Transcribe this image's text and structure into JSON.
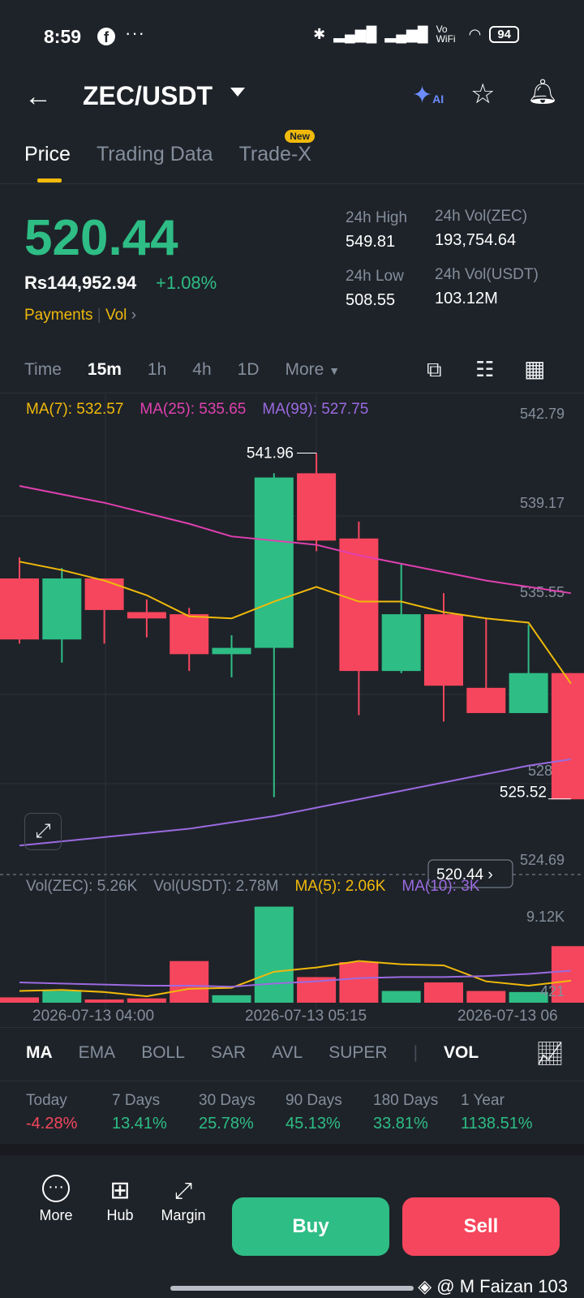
{
  "status": {
    "time": "8:59",
    "fb": "f",
    "dots": "···",
    "network": "Vo WiFi",
    "battery": "94"
  },
  "header": {
    "pair": "ZEC/USDT",
    "ai_label": "AI"
  },
  "tabs": [
    {
      "label": "Price"
    },
    {
      "label": "Trading Data"
    },
    {
      "label": "Trade-X",
      "badge": "New"
    }
  ],
  "price": {
    "last": "520.44",
    "fiat": "Rs144,952.94",
    "change": "+1.08%",
    "payments": "Payments",
    "vol": "Vol"
  },
  "stats": {
    "high_label": "24h High",
    "high": "549.81",
    "low_label": "24h Low",
    "low": "508.55",
    "vol_zec_label": "24h Vol(ZEC)",
    "vol_zec": "193,754.64",
    "vol_usdt_label": "24h Vol(USDT)",
    "vol_usdt": "103.12M"
  },
  "timeframes": [
    "Time",
    "15m",
    "1h",
    "4h",
    "1D",
    "More"
  ],
  "ma_legend": {
    "ma7": "MA(7): 532.57",
    "ma25": "MA(25): 535.65",
    "ma99": "MA(99): 527.75"
  },
  "vol_legend": {
    "zec": "Vol(ZEC): 5.26K",
    "usdt": "Vol(USDT): 2.78M",
    "ma5": "MA(5): 2.06K",
    "ma10": "MA(10): 3K"
  },
  "chart_data": {
    "type": "candlestick",
    "y_ticks": [
      "542.79",
      "539.17",
      "535.55",
      "528.3",
      "524.69"
    ],
    "ylim": [
      522.0,
      543.6
    ],
    "high_marker": "541.96",
    "low_marker": "525.52",
    "last_price_tag": "520.44",
    "x_ticks": [
      "2026-07-13 04:00",
      "2026-07-13 05:15",
      "2026-07-13 06"
    ],
    "candles": [
      {
        "o": 536.0,
        "h": 537.0,
        "l": 532.9,
        "c": 533.1
      },
      {
        "o": 533.1,
        "h": 536.5,
        "l": 532.0,
        "c": 536.0
      },
      {
        "o": 536.0,
        "h": 536.0,
        "l": 532.9,
        "c": 534.5
      },
      {
        "o": 534.4,
        "h": 535.0,
        "l": 533.2,
        "c": 534.1
      },
      {
        "o": 534.3,
        "h": 534.6,
        "l": 531.6,
        "c": 532.4
      },
      {
        "o": 532.4,
        "h": 533.3,
        "l": 531.3,
        "c": 532.7
      },
      {
        "o": 532.7,
        "h": 541.0,
        "l": 525.6,
        "c": 540.8
      },
      {
        "o": 541.0,
        "h": 541.96,
        "l": 537.3,
        "c": 537.8
      },
      {
        "o": 537.9,
        "h": 538.7,
        "l": 529.5,
        "c": 531.6
      },
      {
        "o": 531.6,
        "h": 536.7,
        "l": 531.5,
        "c": 534.3
      },
      {
        "o": 534.3,
        "h": 535.3,
        "l": 529.2,
        "c": 530.9
      },
      {
        "o": 530.8,
        "h": 534.1,
        "l": 529.9,
        "c": 529.6
      },
      {
        "o": 529.6,
        "h": 533.8,
        "l": 530.3,
        "c": 531.5
      },
      {
        "o": 531.5,
        "h": 531.5,
        "l": 525.52,
        "c": 525.5
      }
    ],
    "ma7": [
      536.8,
      536.4,
      535.9,
      535.2,
      534.2,
      534.1,
      534.9,
      535.6,
      534.9,
      534.9,
      534.4,
      534.1,
      533.9,
      531.0
    ],
    "ma25": [
      540.4,
      540.0,
      539.6,
      539.1,
      538.6,
      538.0,
      537.8,
      537.6,
      537.1,
      536.7,
      536.3,
      535.9,
      535.6,
      535.3
    ],
    "ma99": [
      523.3,
      523.5,
      523.7,
      523.9,
      524.1,
      524.4,
      524.7,
      525.1,
      525.5,
      525.9,
      526.3,
      526.7,
      527.1,
      527.4
    ],
    "vol_ticks": [
      "9.12K",
      "421"
    ],
    "volume": [
      0.5,
      1.1,
      0.3,
      0.4,
      3.9,
      0.7,
      9.0,
      2.4,
      3.8,
      1.1,
      1.9,
      1.1,
      1.0,
      5.3
    ],
    "vol_ma5": [
      1.1,
      1.2,
      1.0,
      0.6,
      1.3,
      1.4,
      2.9,
      3.3,
      3.9,
      3.6,
      3.5,
      2.0,
      1.6,
      2.06
    ],
    "vol_ma10": [
      1.9,
      1.8,
      1.7,
      1.6,
      1.6,
      1.5,
      1.8,
      2.0,
      2.3,
      2.4,
      2.4,
      2.5,
      2.7,
      3.0
    ]
  },
  "indicator_tabs": [
    "MA",
    "EMA",
    "BOLL",
    "SAR",
    "AVL",
    "SUPER",
    "VOL"
  ],
  "performance": [
    {
      "label": "Today",
      "value": "-4.28%",
      "color": "#f6465d"
    },
    {
      "label": "7 Days",
      "value": "13.41%",
      "color": "#2ebd85"
    },
    {
      "label": "30 Days",
      "value": "25.78%",
      "color": "#2ebd85"
    },
    {
      "label": "90 Days",
      "value": "45.13%",
      "color": "#2ebd85"
    },
    {
      "label": "180 Days",
      "value": "33.81%",
      "color": "#2ebd85"
    },
    {
      "label": "1 Year",
      "value": "1138.51%",
      "color": "#2ebd85"
    }
  ],
  "bottom": {
    "more": "More",
    "hub": "Hub",
    "margin": "Margin",
    "buy": "Buy",
    "sell": "Sell"
  },
  "watermark": "@ M Faizan 103",
  "colors": {
    "up": "#2ebd85",
    "down": "#f6465d",
    "ma7": "#f0b90b",
    "ma25": "#e040b0",
    "ma99": "#9b6ae0",
    "accent": "#f0b90b"
  }
}
